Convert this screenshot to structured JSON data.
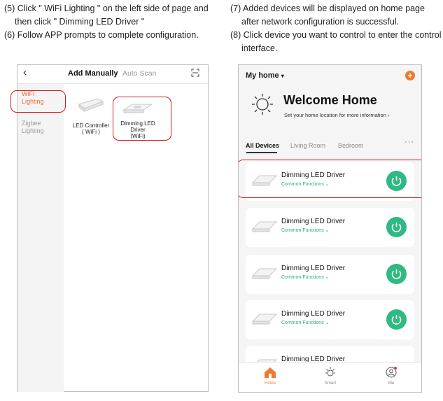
{
  "instructions": {
    "step5_line1": "(5) Click \" WiFi Lighting \" on the left side of page and",
    "step5_line2": "then click \" Dimming LED Driver  \"",
    "step6": "(6)  Follow APP prompts to complete configuration.",
    "step7_line1": "(7) Added devices will be displayed on home page",
    "step7_line2": "after network configuration is successful.",
    "step8_line1": "(8) Click device you want to control to enter the control",
    "step8_line2": "interface."
  },
  "add_screen": {
    "back_icon": "chevron-left-icon",
    "tab_active": "Add Manually",
    "tab_other": "Auto Scan",
    "scan_icon": "scan-icon",
    "categories": [
      {
        "label_line1": "WiFi",
        "label_line2": "Lighting",
        "selected": true
      },
      {
        "label_line1": "Zigbee",
        "label_line2": "Lighting",
        "selected": false
      }
    ],
    "devices": [
      {
        "line1": "LED Controller",
        "line2": "( WiFi )"
      },
      {
        "line1": "Dimming LED Driver",
        "line2": "(WiFi)"
      }
    ]
  },
  "home_screen": {
    "home_selector": "My home",
    "welcome_title": "Welcome Home",
    "location_hint": "Set your home location for more information",
    "tabs": [
      "All Devices",
      "Living Room",
      "Bedroom"
    ],
    "more": "···",
    "devices": [
      {
        "name": "Dimming LED Driver",
        "subtitle": "Common Functions"
      },
      {
        "name": "Dimming LED Driver",
        "subtitle": "Common Functions"
      },
      {
        "name": "Dimming LED Driver",
        "subtitle": "Common Functions"
      },
      {
        "name": "Dimming LED Driver",
        "subtitle": "Common Functions"
      },
      {
        "name": "Dimming LED Driver",
        "subtitle": ""
      }
    ],
    "nav": [
      {
        "label": "Home",
        "icon": "home-icon",
        "active": true
      },
      {
        "label": "Smart",
        "icon": "sun-icon",
        "active": false
      },
      {
        "label": "Me",
        "icon": "user-icon",
        "active": false
      }
    ]
  },
  "colors": {
    "accent_orange": "#ef6b2f",
    "green": "#2fba83",
    "highlight_red": "#d61a1a"
  }
}
